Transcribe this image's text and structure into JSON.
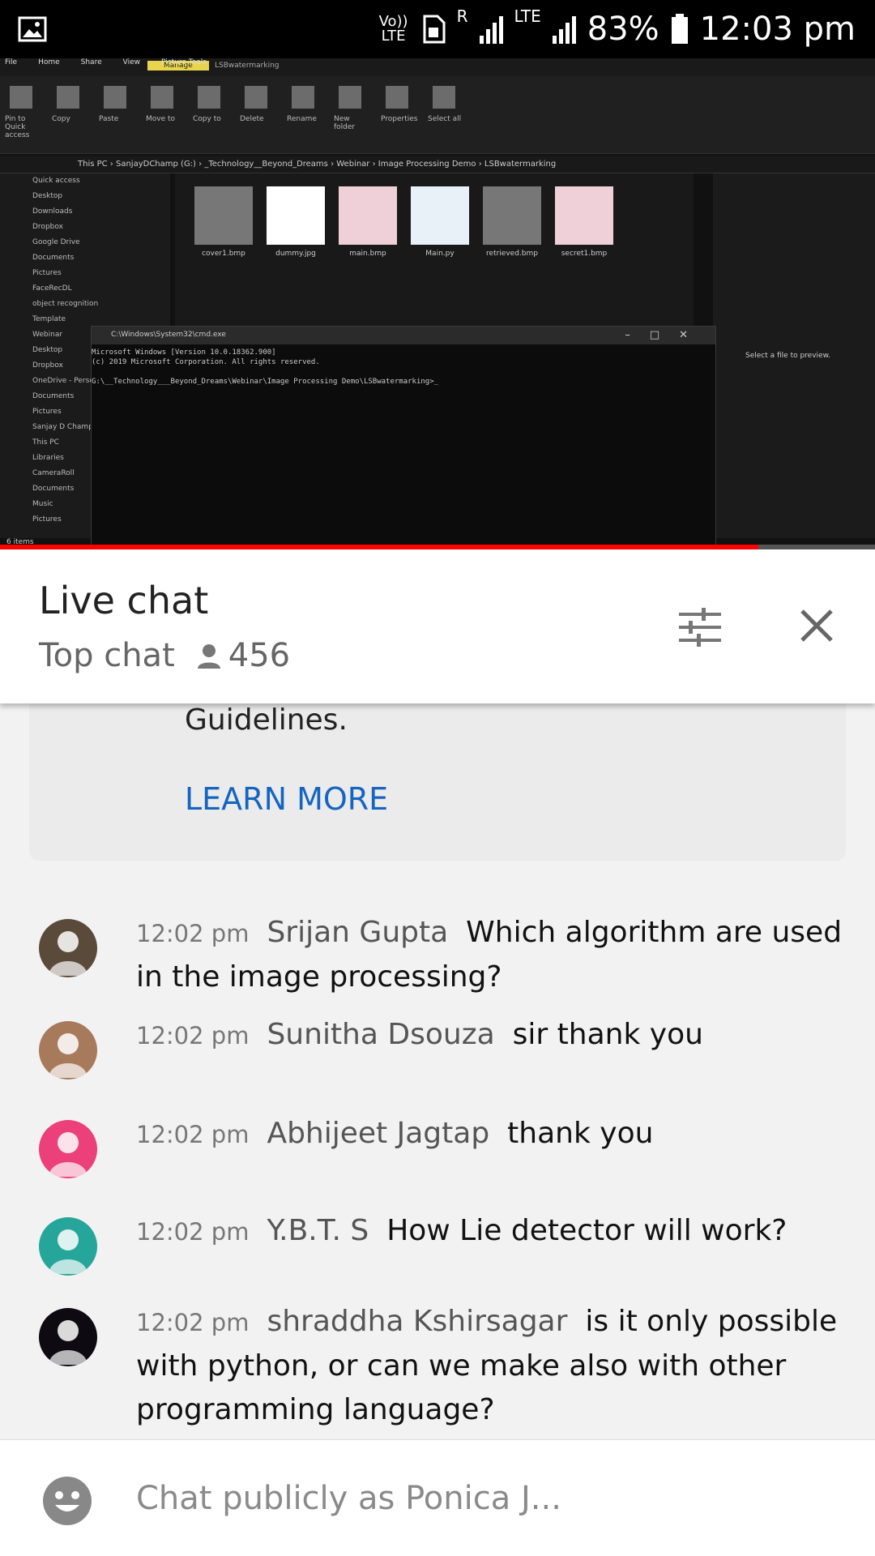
{
  "status_bar": {
    "volte": "Vo)) LTE",
    "roaming": "R",
    "network": "LTE",
    "battery": "83%",
    "time": "12:03 pm"
  },
  "video": {
    "ribbon_tab_manage": "Manage",
    "ribbon_title": "LSBwatermarking",
    "ribbon_tabs": [
      "File",
      "Home",
      "Share",
      "View",
      "Picture Tools"
    ],
    "ribbon_buttons": [
      "Pin to Quick access",
      "Copy",
      "Paste",
      "Move to",
      "Copy to",
      "Delete",
      "Rename",
      "New folder",
      "Properties",
      "Select all"
    ],
    "address": "This PC › SanjayDChamp (G:) › _Technology__Beyond_Dreams › Webinar › Image Processing Demo › LSBwatermarking",
    "nav_items": [
      "Quick access",
      "Desktop",
      "Downloads",
      "Dropbox",
      "Google Drive",
      "Documents",
      "Pictures",
      "FaceRecDL",
      "object recognition",
      "Template",
      "Webinar",
      "Desktop",
      "Dropbox",
      "OneDrive - Perso",
      "Documents",
      "Pictures",
      "Sanjay D Champ",
      "This PC",
      "Libraries",
      "CameraRoll",
      "Documents",
      "Music",
      "Pictures"
    ],
    "files": [
      "cover1.bmp",
      "dummy.jpg",
      "main.bmp",
      "Main.py",
      "retrieved.bmp",
      "secret1.bmp"
    ],
    "preview_text": "Select a file to preview.",
    "items_count": "6 items",
    "cmd_title": "C:\\Windows\\System32\\cmd.exe",
    "cmd_lines": "Microsoft Windows [Version 10.0.18362.900]\n(c) 2019 Microsoft Corporation. All rights reserved.\n\nG:\\__Technology___Beyond_Dreams\\Webinar\\Image Processing Demo\\LSBwatermarking>_",
    "progress_fraction": 0.867
  },
  "chat_header": {
    "title": "Live chat",
    "mode": "Top chat",
    "viewer_count": "456"
  },
  "notice": {
    "text": "Guidelines.",
    "learn_more": "LEARN MORE"
  },
  "messages": [
    {
      "time": "12:02 pm",
      "author": "Srijan Gupta",
      "text": "Which algorithm are used in the image processing?",
      "avatar_color": "#5a4a3a"
    },
    {
      "time": "12:02 pm",
      "author": "Sunitha Dsouza",
      "text": "sir thank you",
      "avatar_color": "#a87a5c"
    },
    {
      "time": "12:02 pm",
      "author": "Abhijeet Jagtap",
      "text": "thank you",
      "avatar_color": "#ec407a"
    },
    {
      "time": "12:02 pm",
      "author": "Y.B.T. S",
      "text": "How Lie detector will work?",
      "avatar_color": "#26a69a"
    },
    {
      "time": "12:02 pm",
      "author": "shraddha Kshirsagar",
      "text": "is it only possible with python, or can we make also with other programming language?",
      "avatar_color": "#0d0a12"
    }
  ],
  "input": {
    "placeholder": "Chat publicly as Ponica J..."
  }
}
